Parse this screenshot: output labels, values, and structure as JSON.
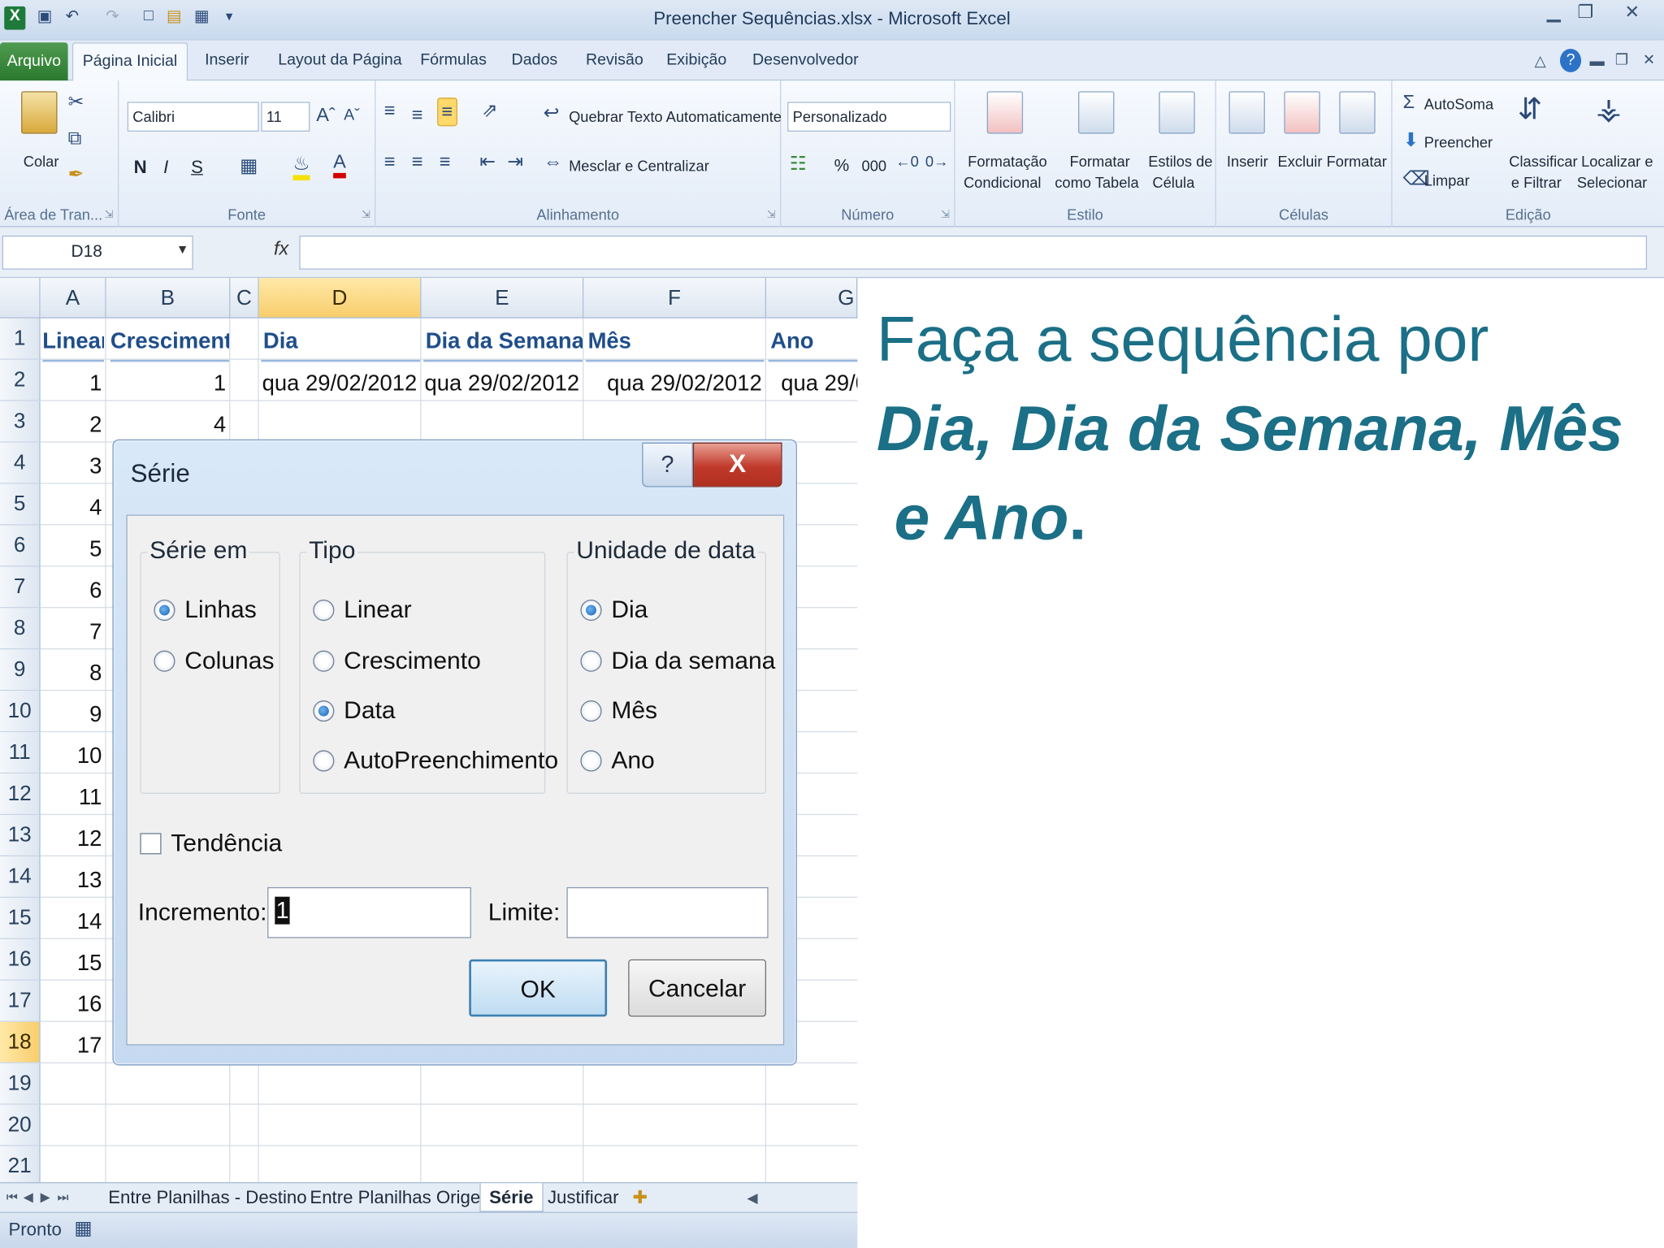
{
  "window": {
    "title": "Preencher Sequências.xlsx - Microsoft Excel",
    "quick_access_icons": [
      "excel-logo-icon",
      "save-icon",
      "undo-icon",
      "redo-icon",
      "new-file-icon",
      "open-icon",
      "print-preview-icon"
    ],
    "controls": [
      "minimize-icon",
      "restore-icon",
      "close-icon"
    ]
  },
  "ribbon": {
    "tabs": [
      "Arquivo",
      "Página Inicial",
      "Inserir",
      "Layout da Página",
      "Fórmulas",
      "Dados",
      "Revisão",
      "Exibição",
      "Desenvolvedor"
    ],
    "active_tab": "Página Inicial",
    "clipboard": {
      "paste": "Colar",
      "label": "Área de Tran..."
    },
    "font": {
      "name": "Calibri",
      "size": "11",
      "bold": "N",
      "italic": "I",
      "underline": "S",
      "label": "Fonte"
    },
    "alignment": {
      "wrap": "Quebrar Texto Automaticamente",
      "merge": "Mesclar e Centralizar",
      "label": "Alinhamento"
    },
    "number": {
      "format": "Personalizado",
      "percent": "%",
      "thousands": "000",
      "label": "Número"
    },
    "style": {
      "conditional_1": "Formatação",
      "conditional_2": "Condicional",
      "table_1": "Formatar",
      "table_2": "como Tabela",
      "cell_1": "Estilos de",
      "cell_2": "Célula",
      "label": "Estilo"
    },
    "cells": {
      "insert": "Inserir",
      "delete": "Excluir",
      "format": "Formatar",
      "label": "Células"
    },
    "editing": {
      "autosum": "AutoSoma",
      "fill": "Preencher",
      "clear": "Limpar",
      "sort_1": "Classificar",
      "sort_2": "e Filtrar",
      "find_1": "Localizar e",
      "find_2": "Selecionar",
      "label": "Edição"
    }
  },
  "formula_bar": {
    "name_box": "D18",
    "fx": "fx",
    "value": ""
  },
  "sheet": {
    "columns": [
      "A",
      "B",
      "C",
      "D",
      "E",
      "F",
      "G"
    ],
    "selected_column": "D",
    "rows": [
      "1",
      "2",
      "3",
      "4",
      "5",
      "6",
      "7",
      "8",
      "9",
      "10",
      "11",
      "12",
      "13",
      "14",
      "15",
      "16",
      "17",
      "18",
      "19",
      "20",
      "21"
    ],
    "selected_row": "18",
    "headers": {
      "A": "Linear",
      "B": "Crescimento",
      "D": "Dia",
      "E": "Dia da Semana",
      "F": "Mês",
      "G": "Ano"
    },
    "row2": {
      "A": "1",
      "B": "1",
      "D": "qua 29/02/2012",
      "E": "qua 29/02/2012",
      "F": "qua 29/02/2012",
      "G": "qua 29/0"
    },
    "row3": {
      "A": "2",
      "B": "4"
    },
    "col_a_values": [
      "3",
      "4",
      "5",
      "6",
      "7",
      "8",
      "9",
      "10",
      "11",
      "12",
      "13",
      "14",
      "15",
      "16",
      "17"
    ]
  },
  "sheet_tabs": {
    "tabs": [
      "Entre Planilhas - Destino",
      "Entre Planilhas Origem",
      "Série",
      "Justificar"
    ],
    "active": "Série"
  },
  "status": {
    "text": "Pronto"
  },
  "dialog": {
    "title": "Série",
    "help": "?",
    "close": "X",
    "series_in": {
      "label": "Série em",
      "options": [
        "Linhas",
        "Colunas"
      ],
      "selected": "Linhas"
    },
    "type": {
      "label": "Tipo",
      "options": [
        "Linear",
        "Crescimento",
        "Data",
        "AutoPreenchimento"
      ],
      "selected": "Data"
    },
    "date_unit": {
      "label": "Unidade de data",
      "options": [
        "Dia",
        "Dia da semana",
        "Mês",
        "Ano"
      ],
      "selected": "Dia"
    },
    "trend": {
      "label": "Tendência",
      "checked": false
    },
    "increment": {
      "label": "Incremento:",
      "value": "1"
    },
    "limit": {
      "label": "Limite:",
      "value": ""
    },
    "ok": "OK",
    "cancel": "Cancelar"
  },
  "note": {
    "line1": "Faça a sequência por",
    "line2": "Dia, Dia da Semana, Mês",
    "line3": " e Ano",
    "line3_end": "."
  }
}
